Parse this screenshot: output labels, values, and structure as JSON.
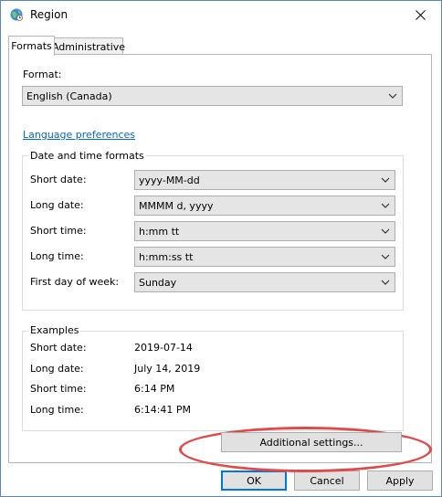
{
  "window": {
    "title": "Region"
  },
  "tabs": [
    {
      "label": "Formats",
      "active": true
    },
    {
      "label": "Administrative",
      "active": false
    }
  ],
  "format": {
    "label": "Format:",
    "value": "English (Canada)"
  },
  "language_link": "Language preferences",
  "date_time": {
    "title": "Date and time formats",
    "rows": [
      {
        "label": "Short date:",
        "value": "yyyy-MM-dd"
      },
      {
        "label": "Long date:",
        "value": "MMMM d, yyyy"
      },
      {
        "label": "Short time:",
        "value": "h:mm tt"
      },
      {
        "label": "Long time:",
        "value": "h:mm:ss tt"
      },
      {
        "label": "First day of week:",
        "value": "Sunday"
      }
    ]
  },
  "examples": {
    "title": "Examples",
    "rows": [
      {
        "label": "Short date:",
        "value": "2019-07-14"
      },
      {
        "label": "Long date:",
        "value": "July 14, 2019"
      },
      {
        "label": "Short time:",
        "value": "6:14 PM"
      },
      {
        "label": "Long time:",
        "value": "6:14:41 PM"
      }
    ]
  },
  "buttons": {
    "additional": "Additional settings...",
    "ok": "OK",
    "cancel": "Cancel",
    "apply": "Apply"
  },
  "colors": {
    "highlight": "#e04a4a",
    "link": "#0066cc",
    "accent": "#0078d7"
  }
}
